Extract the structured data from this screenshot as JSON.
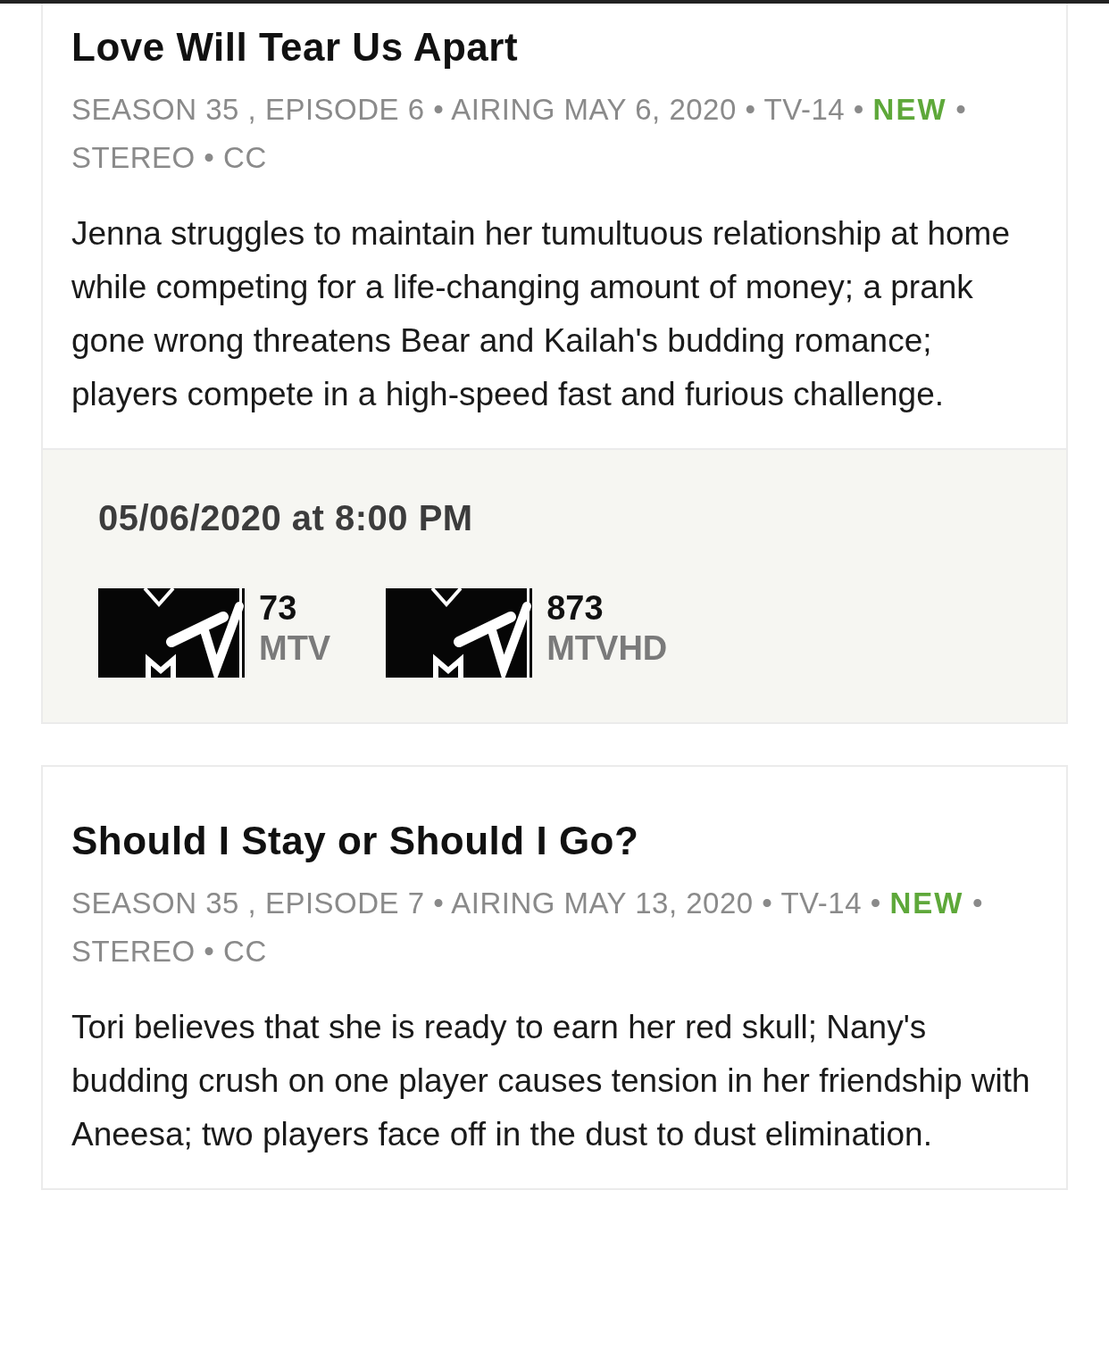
{
  "episodes": [
    {
      "title": "Love Will Tear Us Apart",
      "meta": [
        {
          "text": "SEASON 35 , EPISODE 6 • AIRING MAY 6, 2020 • TV-14 •",
          "kind": "plain"
        },
        {
          "text": "NEW",
          "kind": "new"
        },
        {
          "text": "• STEREO • CC",
          "kind": "plain"
        }
      ],
      "description": "Jenna struggles to maintain her tumultuous relationship at home while competing for a life-changing amount of money; a prank gone wrong threatens Bear and Kailah's budding romance; players compete in a high-speed fast and furious challenge.",
      "airing": {
        "datetime": "05/06/2020 at 8:00 PM",
        "channels": [
          {
            "number": "73",
            "name": "MTV"
          },
          {
            "number": "873",
            "name": "MTVHD"
          }
        ]
      }
    },
    {
      "title": "Should I Stay or Should I Go?",
      "meta": [
        {
          "text": "SEASON 35 , EPISODE 7 • AIRING MAY 13, 2020 • TV-14 •",
          "kind": "plain"
        },
        {
          "text": "NEW",
          "kind": "new"
        },
        {
          "text": "• STEREO • CC",
          "kind": "plain"
        }
      ],
      "description": "Tori believes that she is ready to earn her red skull; Nany's budding crush on one player causes tension in her friendship with Aneesa; two players face off in the dust to dust elimination."
    }
  ]
}
